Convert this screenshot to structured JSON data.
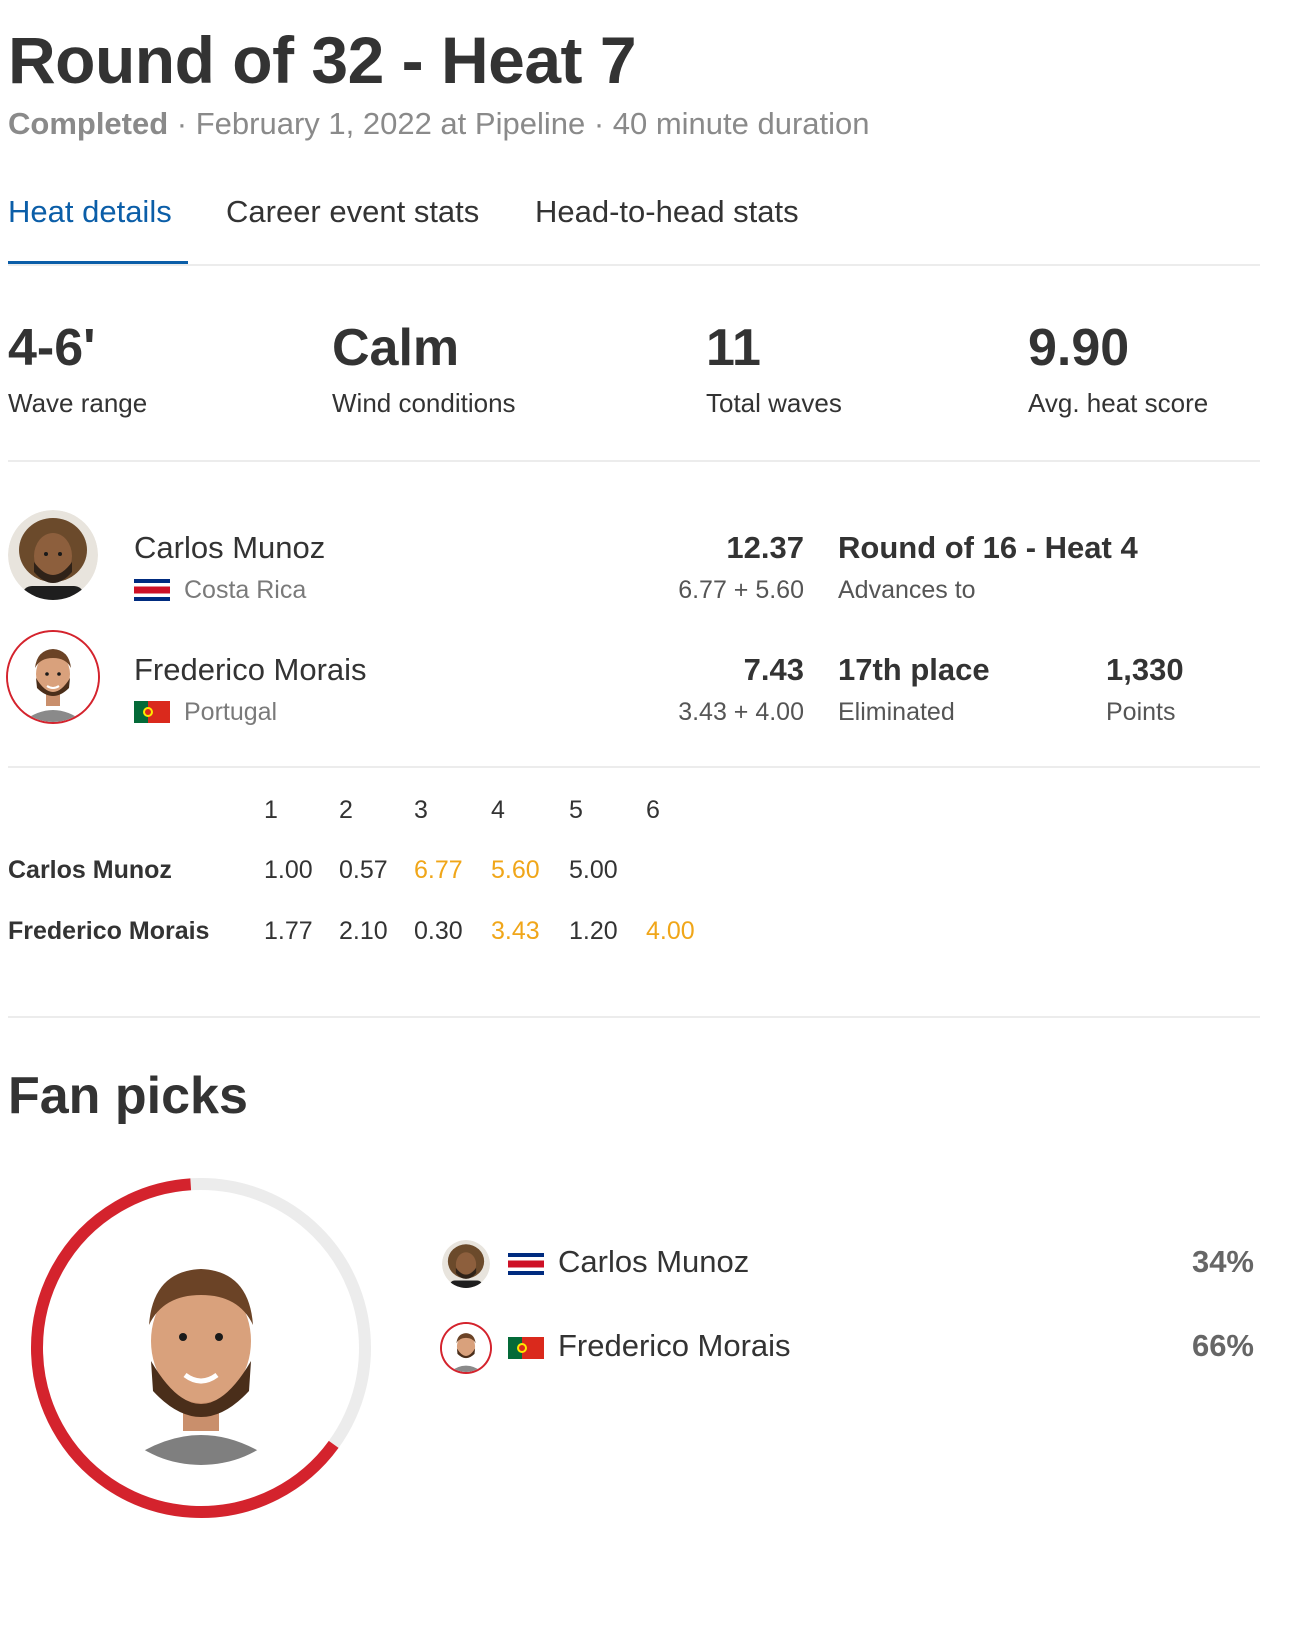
{
  "heat": {
    "title": "Round of 32 - Heat 7",
    "status": "Completed",
    "meta": " · February 1, 2022 at Pipeline · 40 minute duration"
  },
  "tabs": [
    {
      "label": "Heat details",
      "active": true
    },
    {
      "label": "Career event stats",
      "active": false
    },
    {
      "label": "Head-to-head stats",
      "active": false
    }
  ],
  "stats": [
    {
      "value": "4-6'",
      "label": "Wave range"
    },
    {
      "value": "Calm",
      "label": "Wind conditions"
    },
    {
      "value": "11",
      "label": "Total waves"
    },
    {
      "value": "9.90",
      "label": "Avg. heat score"
    }
  ],
  "surfers": [
    {
      "name": "Carlos Munoz",
      "country": "Costa Rica",
      "flag_icon": "costa-rica-flag-icon",
      "total": "12.37",
      "waves": "6.77 + 5.60",
      "result_main": "Round of 16 - Heat 4",
      "result_sub": "Advances to"
    },
    {
      "name": "Frederico Morais",
      "country": "Portugal",
      "flag_icon": "portugal-flag-icon",
      "total": "7.43",
      "waves": "3.43 + 4.00",
      "result_main": "17th place",
      "result_sub": "Eliminated",
      "points_main": "1,330",
      "points_sub": "Points"
    }
  ],
  "wave_scores": {
    "headers": [
      "1",
      "2",
      "3",
      "4",
      "5",
      "6"
    ],
    "rows": [
      {
        "name": "Carlos Munoz",
        "scores": [
          "1.00",
          "0.57",
          "6.77",
          "5.60",
          "5.00"
        ],
        "counted": [
          2,
          3
        ]
      },
      {
        "name": "Frederico Morais",
        "scores": [
          "1.77",
          "2.10",
          "0.30",
          "3.43",
          "1.20",
          "4.00"
        ],
        "counted": [
          3,
          5
        ]
      }
    ]
  },
  "fan_picks": {
    "title": "Fan picks",
    "items": [
      {
        "name": "Carlos Munoz",
        "pct": "34%",
        "value": 34
      },
      {
        "name": "Frederico Morais",
        "pct": "66%",
        "value": 66
      }
    ]
  },
  "colors": {
    "accent": "#0b5ea8",
    "counted_score": "#f0a619",
    "fan_ring": "#d4232d",
    "ring_track": "#ececec"
  }
}
